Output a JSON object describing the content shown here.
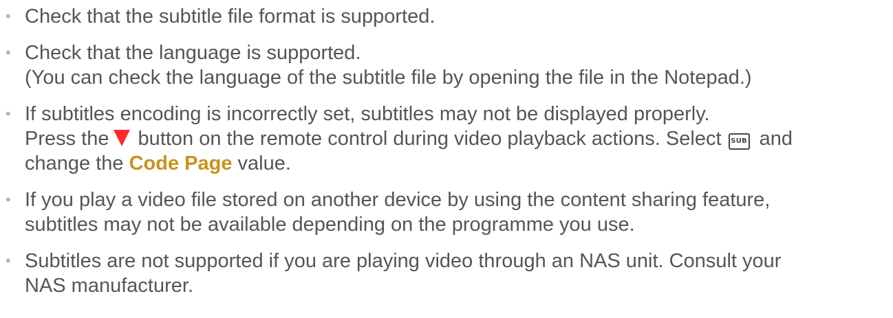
{
  "items": [
    {
      "lines": [
        "Check that the subtitle file format is supported."
      ]
    },
    {
      "lines": [
        "Check that the language is supported.",
        "(You can check the language of the subtitle file by opening the file in the Notepad.)"
      ]
    },
    {
      "line1": "If subtitles encoding is incorrectly set, subtitles may not be displayed properly.",
      "line2_pre": "Press the",
      "line2_mid": " button on the remote control during video playback actions. Select",
      "sub_icon_label": "SUB",
      "line2_post": " and",
      "line3_pre": "change the ",
      "highlight": "Code Page",
      "line3_post": " value."
    },
    {
      "lines": [
        "If you play a video file stored on another device by using the content sharing feature,",
        "subtitles may not be available depending on the programme you use."
      ]
    },
    {
      "lines": [
        "Subtitles are not supported if you are playing video through an NAS unit. Consult your",
        "NAS manufacturer."
      ]
    }
  ],
  "colors": {
    "text": "#555555",
    "bullet": "#b5b5b5",
    "highlight": "#c8921c",
    "triangle": "#ff2a2a"
  },
  "icons": {
    "remote_button": "red-down-triangle-icon",
    "subtitle_button": "sub-button-icon"
  },
  "bullet_glyph": "•"
}
